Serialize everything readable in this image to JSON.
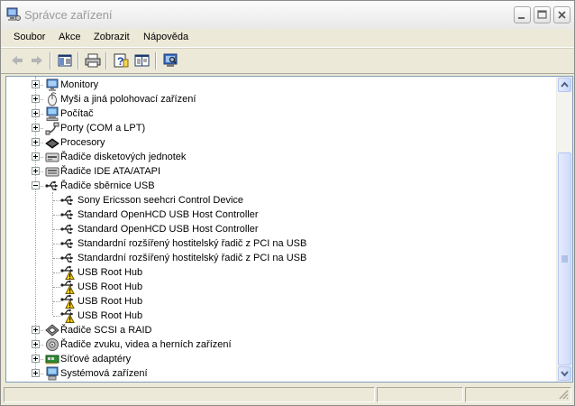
{
  "window": {
    "title": "Správce zařízení"
  },
  "menu": [
    "Soubor",
    "Akce",
    "Zobrazit",
    "Nápověda"
  ],
  "toolbar": [
    "back-icon",
    "forward-icon",
    "show-hide-tree-icon",
    "print-icon",
    "help-icon",
    "properties-icon",
    "scan-hardware-icon"
  ],
  "tree": {
    "items": [
      {
        "label": "Monitory",
        "icon": "monitor-icon",
        "expander": "plus"
      },
      {
        "label": "Myši a jiná polohovací zařízení",
        "icon": "mouse-icon",
        "expander": "plus"
      },
      {
        "label": "Počítač",
        "icon": "computer-icon",
        "expander": "plus"
      },
      {
        "label": "Porty (COM a LPT)",
        "icon": "port-icon",
        "expander": "plus"
      },
      {
        "label": "Procesory",
        "icon": "processor-icon",
        "expander": "plus"
      },
      {
        "label": "Řadiče disketových jednotek",
        "icon": "floppy-controller-icon",
        "expander": "plus"
      },
      {
        "label": "Řadiče IDE ATA/ATAPI",
        "icon": "ide-controller-icon",
        "expander": "plus"
      },
      {
        "label": "Řadiče sběrnice USB",
        "icon": "usb-icon",
        "expander": "minus"
      },
      {
        "label": "Sony Ericsson seehcri Control Device",
        "icon": "usb-icon",
        "child": true
      },
      {
        "label": "Standard OpenHCD USB Host Controller",
        "icon": "usb-icon",
        "child": true
      },
      {
        "label": "Standard OpenHCD USB Host Controller",
        "icon": "usb-icon",
        "child": true
      },
      {
        "label": "Standardní rozšířený hostitelský řadič z PCI na USB",
        "icon": "usb-icon",
        "child": true
      },
      {
        "label": "Standardní rozšířený hostitelský řadič z PCI na USB",
        "icon": "usb-icon",
        "child": true
      },
      {
        "label": "USB Root Hub",
        "icon": "usb-warning-icon",
        "child": true
      },
      {
        "label": "USB Root Hub",
        "icon": "usb-warning-icon",
        "child": true
      },
      {
        "label": "USB Root Hub",
        "icon": "usb-warning-icon",
        "child": true
      },
      {
        "label": "USB Root Hub",
        "icon": "usb-warning-icon",
        "child": true
      },
      {
        "label": "Řadiče SCSI a RAID",
        "icon": "scsi-icon",
        "expander": "plus"
      },
      {
        "label": "Řadiče zvuku, videa a herních zařízení",
        "icon": "sound-icon",
        "expander": "plus"
      },
      {
        "label": "Síťové adaptéry",
        "icon": "network-adapter-icon",
        "expander": "plus"
      },
      {
        "label": "Systémová zařízení",
        "icon": "system-device-icon",
        "expander": "plus"
      }
    ]
  },
  "colors": {
    "accent": "#7f9db9",
    "warning": "#f5d000"
  }
}
